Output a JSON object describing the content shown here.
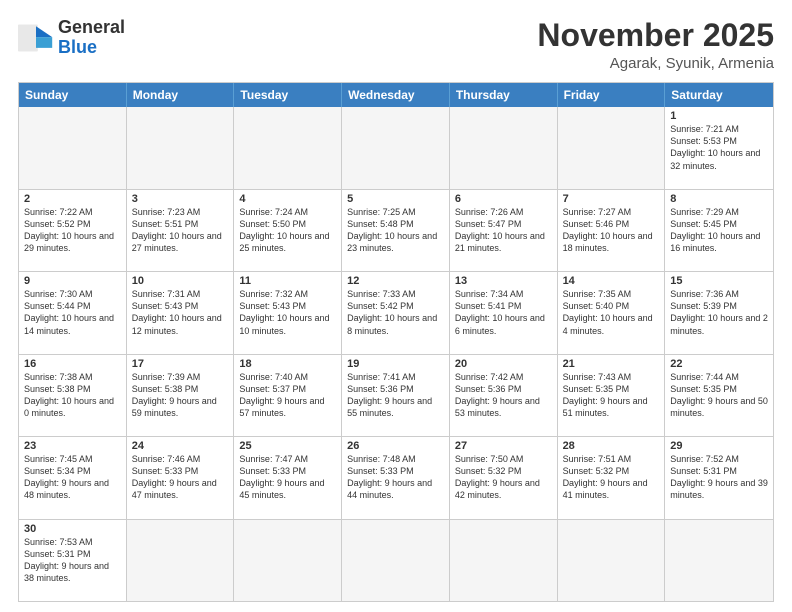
{
  "logo": {
    "general": "General",
    "blue": "Blue"
  },
  "header": {
    "month_year": "November 2025",
    "location": "Agarak, Syunik, Armenia"
  },
  "days": [
    "Sunday",
    "Monday",
    "Tuesday",
    "Wednesday",
    "Thursday",
    "Friday",
    "Saturday"
  ],
  "weeks": [
    [
      {
        "day": "",
        "info": "",
        "empty": true
      },
      {
        "day": "",
        "info": "",
        "empty": true
      },
      {
        "day": "",
        "info": "",
        "empty": true
      },
      {
        "day": "",
        "info": "",
        "empty": true
      },
      {
        "day": "",
        "info": "",
        "empty": true
      },
      {
        "day": "",
        "info": "",
        "empty": true
      },
      {
        "day": "1",
        "info": "Sunrise: 7:21 AM\nSunset: 5:53 PM\nDaylight: 10 hours and 32 minutes."
      }
    ],
    [
      {
        "day": "2",
        "info": "Sunrise: 7:22 AM\nSunset: 5:52 PM\nDaylight: 10 hours and 29 minutes."
      },
      {
        "day": "3",
        "info": "Sunrise: 7:23 AM\nSunset: 5:51 PM\nDaylight: 10 hours and 27 minutes."
      },
      {
        "day": "4",
        "info": "Sunrise: 7:24 AM\nSunset: 5:50 PM\nDaylight: 10 hours and 25 minutes."
      },
      {
        "day": "5",
        "info": "Sunrise: 7:25 AM\nSunset: 5:48 PM\nDaylight: 10 hours and 23 minutes."
      },
      {
        "day": "6",
        "info": "Sunrise: 7:26 AM\nSunset: 5:47 PM\nDaylight: 10 hours and 21 minutes."
      },
      {
        "day": "7",
        "info": "Sunrise: 7:27 AM\nSunset: 5:46 PM\nDaylight: 10 hours and 18 minutes."
      },
      {
        "day": "8",
        "info": "Sunrise: 7:29 AM\nSunset: 5:45 PM\nDaylight: 10 hours and 16 minutes."
      }
    ],
    [
      {
        "day": "9",
        "info": "Sunrise: 7:30 AM\nSunset: 5:44 PM\nDaylight: 10 hours and 14 minutes."
      },
      {
        "day": "10",
        "info": "Sunrise: 7:31 AM\nSunset: 5:43 PM\nDaylight: 10 hours and 12 minutes."
      },
      {
        "day": "11",
        "info": "Sunrise: 7:32 AM\nSunset: 5:43 PM\nDaylight: 10 hours and 10 minutes."
      },
      {
        "day": "12",
        "info": "Sunrise: 7:33 AM\nSunset: 5:42 PM\nDaylight: 10 hours and 8 minutes."
      },
      {
        "day": "13",
        "info": "Sunrise: 7:34 AM\nSunset: 5:41 PM\nDaylight: 10 hours and 6 minutes."
      },
      {
        "day": "14",
        "info": "Sunrise: 7:35 AM\nSunset: 5:40 PM\nDaylight: 10 hours and 4 minutes."
      },
      {
        "day": "15",
        "info": "Sunrise: 7:36 AM\nSunset: 5:39 PM\nDaylight: 10 hours and 2 minutes."
      }
    ],
    [
      {
        "day": "16",
        "info": "Sunrise: 7:38 AM\nSunset: 5:38 PM\nDaylight: 10 hours and 0 minutes."
      },
      {
        "day": "17",
        "info": "Sunrise: 7:39 AM\nSunset: 5:38 PM\nDaylight: 9 hours and 59 minutes."
      },
      {
        "day": "18",
        "info": "Sunrise: 7:40 AM\nSunset: 5:37 PM\nDaylight: 9 hours and 57 minutes."
      },
      {
        "day": "19",
        "info": "Sunrise: 7:41 AM\nSunset: 5:36 PM\nDaylight: 9 hours and 55 minutes."
      },
      {
        "day": "20",
        "info": "Sunrise: 7:42 AM\nSunset: 5:36 PM\nDaylight: 9 hours and 53 minutes."
      },
      {
        "day": "21",
        "info": "Sunrise: 7:43 AM\nSunset: 5:35 PM\nDaylight: 9 hours and 51 minutes."
      },
      {
        "day": "22",
        "info": "Sunrise: 7:44 AM\nSunset: 5:35 PM\nDaylight: 9 hours and 50 minutes."
      }
    ],
    [
      {
        "day": "23",
        "info": "Sunrise: 7:45 AM\nSunset: 5:34 PM\nDaylight: 9 hours and 48 minutes."
      },
      {
        "day": "24",
        "info": "Sunrise: 7:46 AM\nSunset: 5:33 PM\nDaylight: 9 hours and 47 minutes."
      },
      {
        "day": "25",
        "info": "Sunrise: 7:47 AM\nSunset: 5:33 PM\nDaylight: 9 hours and 45 minutes."
      },
      {
        "day": "26",
        "info": "Sunrise: 7:48 AM\nSunset: 5:33 PM\nDaylight: 9 hours and 44 minutes."
      },
      {
        "day": "27",
        "info": "Sunrise: 7:50 AM\nSunset: 5:32 PM\nDaylight: 9 hours and 42 minutes."
      },
      {
        "day": "28",
        "info": "Sunrise: 7:51 AM\nSunset: 5:32 PM\nDaylight: 9 hours and 41 minutes."
      },
      {
        "day": "29",
        "info": "Sunrise: 7:52 AM\nSunset: 5:31 PM\nDaylight: 9 hours and 39 minutes."
      }
    ],
    [
      {
        "day": "30",
        "info": "Sunrise: 7:53 AM\nSunset: 5:31 PM\nDaylight: 9 hours and 38 minutes."
      },
      {
        "day": "",
        "info": "",
        "empty": true
      },
      {
        "day": "",
        "info": "",
        "empty": true
      },
      {
        "day": "",
        "info": "",
        "empty": true
      },
      {
        "day": "",
        "info": "",
        "empty": true
      },
      {
        "day": "",
        "info": "",
        "empty": true
      },
      {
        "day": "",
        "info": "",
        "empty": true
      }
    ]
  ]
}
